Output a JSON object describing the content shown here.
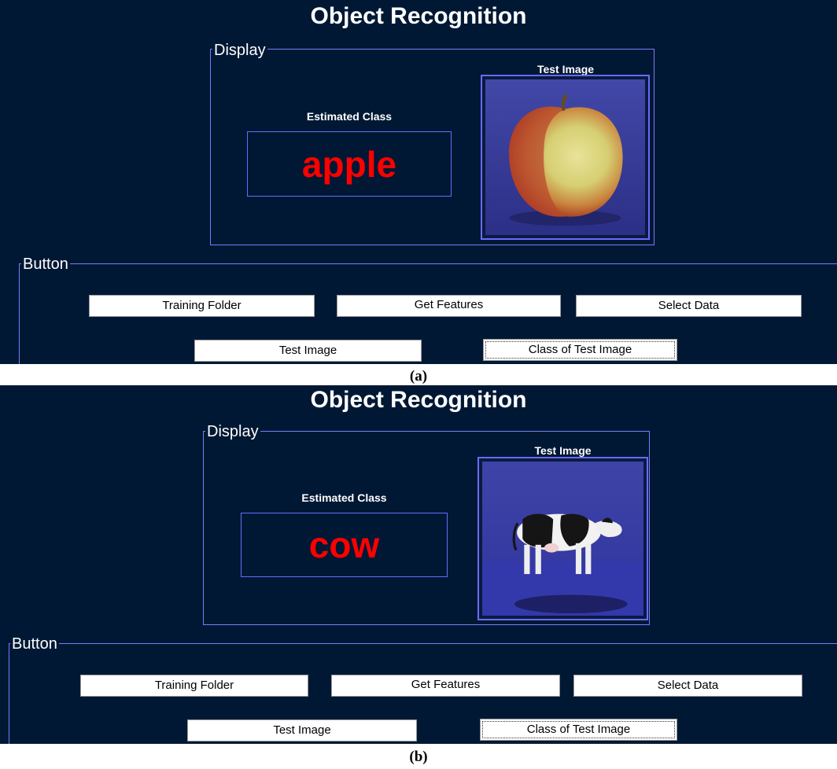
{
  "panels": [
    {
      "title": "Object Recognition",
      "display_label": "Display",
      "estimated_class_label": "Estimated Class",
      "estimated_class_value": "apple",
      "test_image_label": "Test Image",
      "button_group_label": "Button",
      "buttons": {
        "training_folder": "Training Folder",
        "get_features": "Get Features",
        "select_data": "Select Data",
        "test_image": "Test Image",
        "class_of_test_image": "Class of Test Image"
      },
      "caption": "(a)"
    },
    {
      "title": "Object Recognition",
      "display_label": "Display",
      "estimated_class_label": "Estimated Class",
      "estimated_class_value": "cow",
      "test_image_label": "Test Image",
      "button_group_label": "Button",
      "buttons": {
        "training_folder": "Training Folder",
        "get_features": "Get Features",
        "select_data": "Select Data",
        "test_image": "Test Image",
        "class_of_test_image": "Class of Test Image"
      },
      "caption": "(b)"
    }
  ],
  "colors": {
    "background": "#001834",
    "border": "#7b7bff",
    "estimated_class_text": "#ff0000",
    "photo_background": "#3a3ea0"
  }
}
